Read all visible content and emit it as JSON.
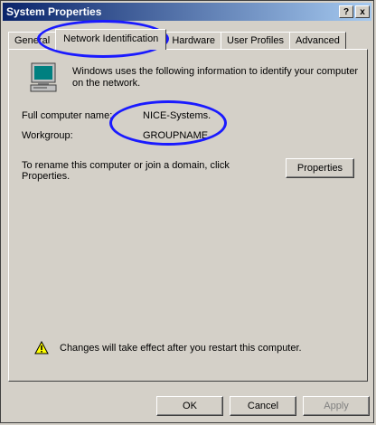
{
  "window": {
    "title": "System Properties",
    "help_label": "?",
    "close_label": "x"
  },
  "tabs": [
    {
      "label": "General"
    },
    {
      "label": "Network Identification"
    },
    {
      "label": "Hardware"
    },
    {
      "label": "User Profiles"
    },
    {
      "label": "Advanced"
    }
  ],
  "panel": {
    "intro_text": "Windows uses the following information to identify your computer on the network.",
    "full_name_label": "Full computer name:",
    "full_name_value": "NICE-Systems.",
    "workgroup_label": "Workgroup:",
    "workgroup_value": "GROUPNAME",
    "rename_text": "To rename this computer or join a domain, click Properties.",
    "properties_button": "Properties",
    "warning_text": "Changes will take effect after you restart this computer."
  },
  "footer": {
    "ok_label": "OK",
    "cancel_label": "Cancel",
    "apply_label": "Apply"
  },
  "colors": {
    "annotation": "#1a1aff",
    "titlebar_start": "#0a246a",
    "titlebar_end": "#a6caf0"
  }
}
